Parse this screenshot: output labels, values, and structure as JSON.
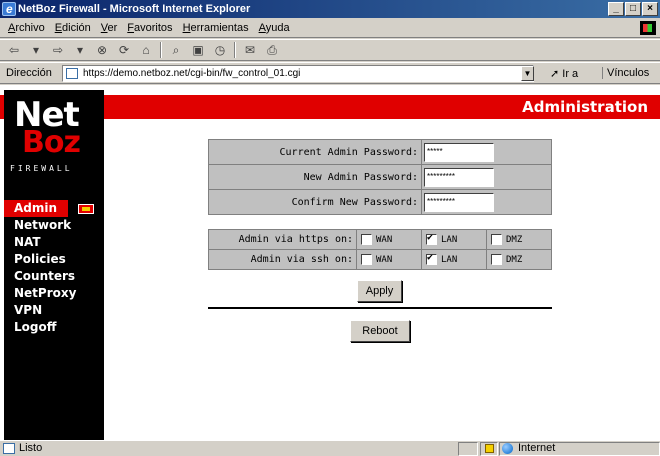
{
  "window": {
    "title": "NetBoz Firewall - Microsoft Internet Explorer",
    "buttons": [
      "_",
      "□",
      "×"
    ]
  },
  "menu": [
    "Archivo",
    "Edición",
    "Ver",
    "Favoritos",
    "Herramientas",
    "Ayuda"
  ],
  "toolbar": {
    "icons": [
      "back-icon",
      "forward-icon",
      "stop-icon",
      "refresh-icon",
      "home-icon",
      "search-icon",
      "favorites-icon",
      "history-icon",
      "mail-icon",
      "print-icon"
    ]
  },
  "address": {
    "label": "Dirección",
    "url": "https://demo.netboz.net/cgi-bin/fw_control_01.cgi",
    "go_label": "Ir a",
    "links_label": "Vínculos"
  },
  "page": {
    "heading": "Administration",
    "logo": {
      "net": "Net",
      "boz": "Boz",
      "sub": "FIREWALL"
    },
    "nav": [
      "Admin",
      "Network",
      "NAT",
      "Policies",
      "Counters",
      "NetProxy",
      "VPN",
      "Logoff"
    ],
    "password_form": {
      "rows": [
        {
          "label": "Current Admin Password:",
          "value": "*****"
        },
        {
          "label": "New Admin Password:",
          "value": "*********"
        },
        {
          "label": "Confirm New Password:",
          "value": "*********"
        }
      ]
    },
    "access_form": {
      "rows": [
        {
          "label": "Admin via https on:",
          "options": [
            {
              "label": "WAN",
              "checked": false
            },
            {
              "label": "LAN",
              "checked": true
            },
            {
              "label": "DMZ",
              "checked": false
            }
          ]
        },
        {
          "label": "Admin via ssh on:",
          "options": [
            {
              "label": "WAN",
              "checked": false
            },
            {
              "label": "LAN",
              "checked": true
            },
            {
              "label": "DMZ",
              "checked": false
            }
          ]
        }
      ]
    },
    "apply_label": "Apply",
    "reboot_label": "Reboot"
  },
  "status": {
    "text": "Listo",
    "zone": "Internet"
  }
}
